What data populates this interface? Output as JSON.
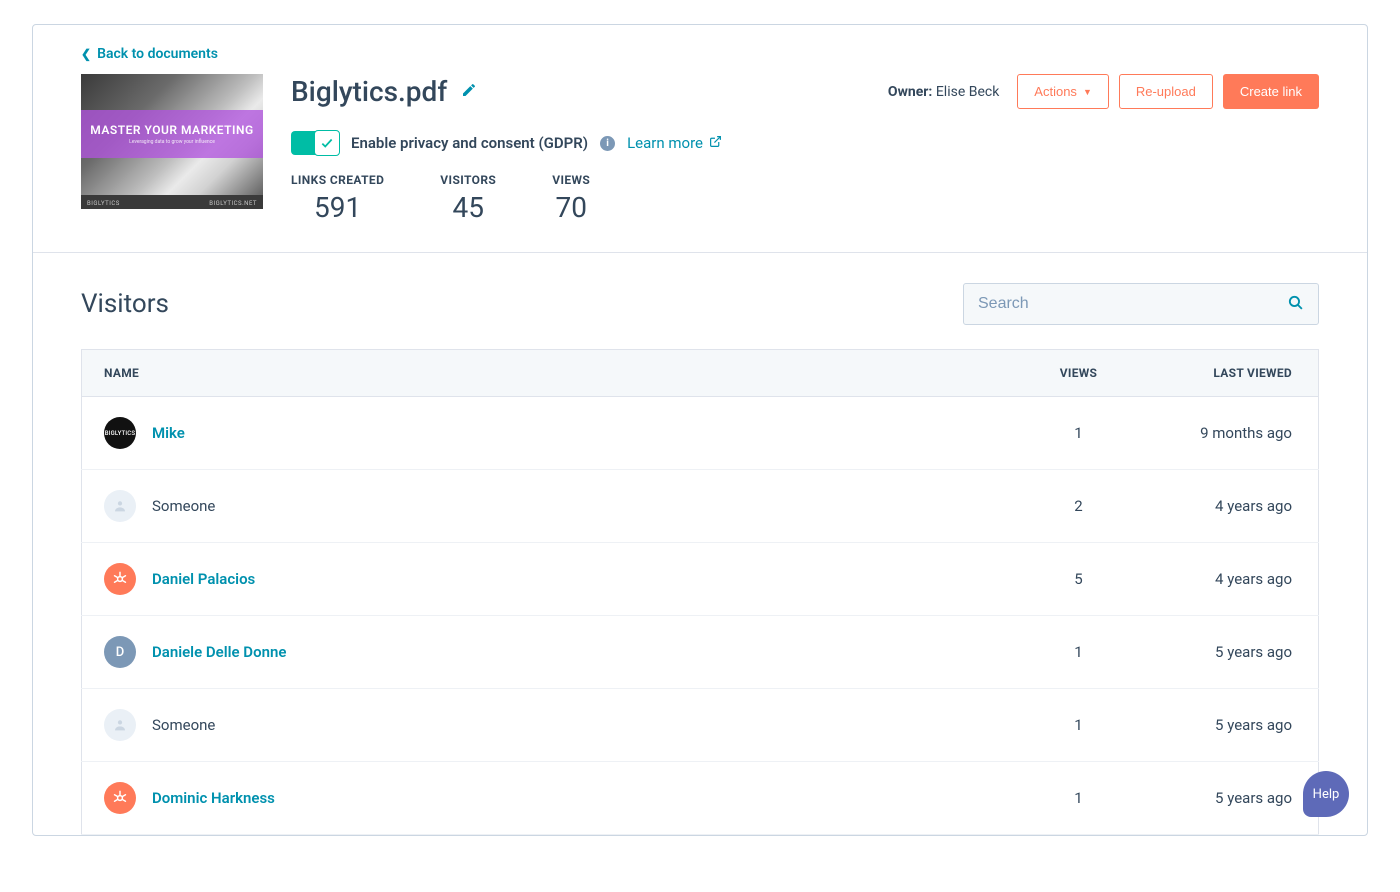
{
  "back_link": "Back to documents",
  "doc": {
    "title": "Biglytics.pdf",
    "thumb_headline": "MASTER YOUR MARKETING",
    "thumb_sub": "Leveraging data to grow your influence",
    "thumb_brand_l": "BIGLYTICS",
    "thumb_brand_r": "BIGLYTICS.NET"
  },
  "owner_label": "Owner:",
  "owner_name": "Elise Beck",
  "buttons": {
    "actions": "Actions",
    "reupload": "Re-upload",
    "create_link": "Create link"
  },
  "gdpr": {
    "label": "Enable privacy and consent (GDPR)",
    "learn_more": "Learn more"
  },
  "stats": [
    {
      "label": "LINKS CREATED",
      "value": "591"
    },
    {
      "label": "VISITORS",
      "value": "45"
    },
    {
      "label": "VIEWS",
      "value": "70"
    }
  ],
  "visitors_title": "Visitors",
  "search_placeholder": "Search",
  "columns": {
    "name": "NAME",
    "views": "VIEWS",
    "last": "LAST VIEWED"
  },
  "rows": [
    {
      "name": "Mike",
      "link": true,
      "views": "1",
      "last": "9 months ago",
      "avatar": "dark",
      "initial": "BIGLYTICS"
    },
    {
      "name": "Someone",
      "link": false,
      "views": "2",
      "last": "4 years ago",
      "avatar": "grey",
      "initial": ""
    },
    {
      "name": "Daniel Palacios",
      "link": true,
      "views": "5",
      "last": "4 years ago",
      "avatar": "orange",
      "initial": "sprocket"
    },
    {
      "name": "Daniele Delle Donne",
      "link": true,
      "views": "1",
      "last": "5 years ago",
      "avatar": "bluegrey",
      "initial": "D"
    },
    {
      "name": "Someone",
      "link": false,
      "views": "1",
      "last": "5 years ago",
      "avatar": "grey",
      "initial": ""
    },
    {
      "name": "Dominic Harkness",
      "link": true,
      "views": "1",
      "last": "5 years ago",
      "avatar": "orange",
      "initial": "sprocket"
    }
  ],
  "help": "Help"
}
